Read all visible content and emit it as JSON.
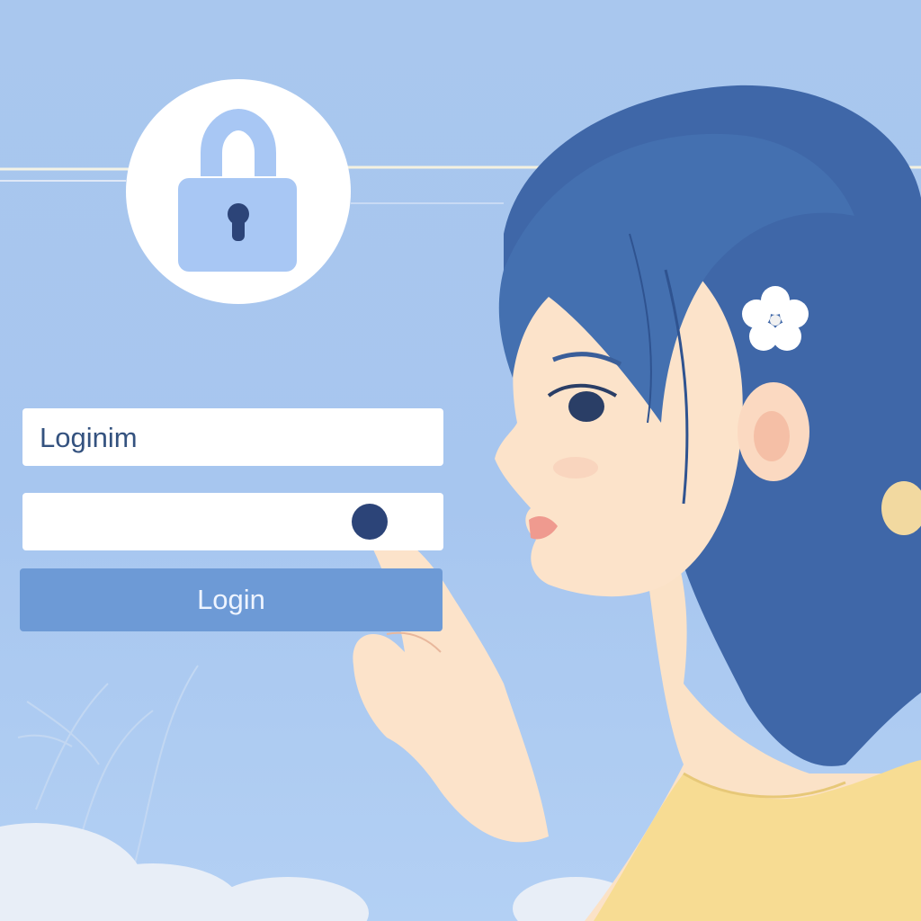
{
  "login_form": {
    "username_value": "Loginim",
    "password_masked": true,
    "submit_label": "Login"
  },
  "icons": {
    "lock": "padlock-icon",
    "flower": "flower-hairpin"
  },
  "colors": {
    "background": "#a9c7ee",
    "button": "#6d9ad6",
    "lock_fill": "#a8c7f4",
    "hair": "#3f67a8",
    "shirt": "#f7dc93"
  }
}
